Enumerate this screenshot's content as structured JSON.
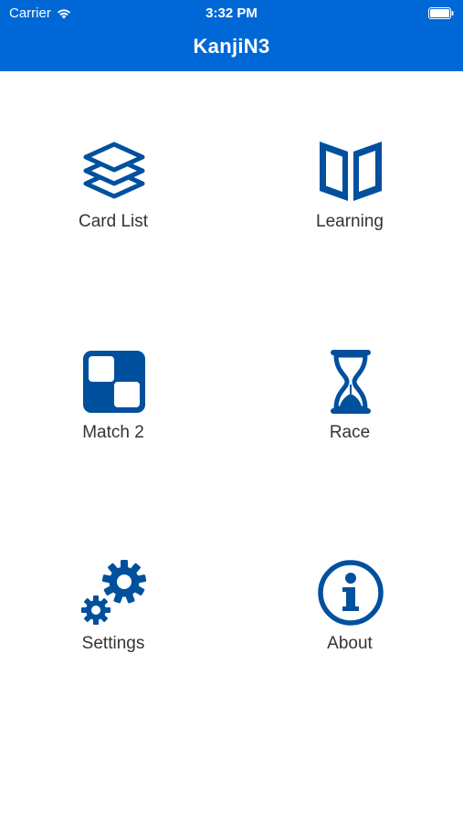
{
  "status_bar": {
    "carrier": "Carrier",
    "time": "3:32 PM"
  },
  "nav": {
    "title": "KanjiN3"
  },
  "colors": {
    "accent": "#0068d6",
    "icon": "#00509e",
    "label": "#333333"
  },
  "menu": {
    "card_list": "Card List",
    "learning": "Learning",
    "match2": "Match 2",
    "race": "Race",
    "settings": "Settings",
    "about": "About"
  }
}
